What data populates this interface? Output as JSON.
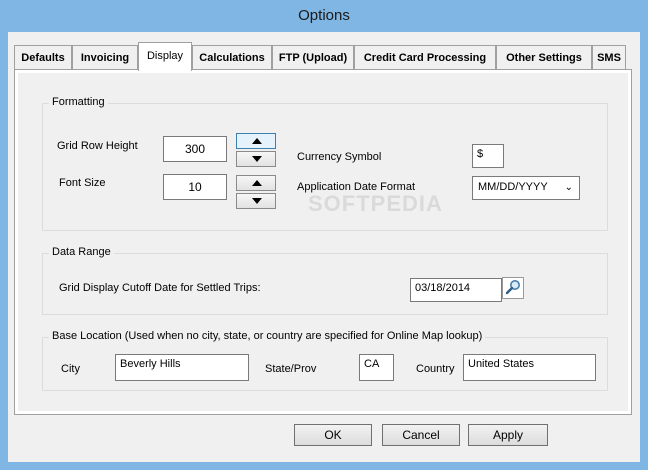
{
  "window": {
    "title": "Options"
  },
  "tabs": [
    {
      "label": "Defaults"
    },
    {
      "label": "Invoicing"
    },
    {
      "label": "Display",
      "active": true
    },
    {
      "label": "Calculations"
    },
    {
      "label": "FTP (Upload)"
    },
    {
      "label": "Credit Card Processing"
    },
    {
      "label": "Other Settings"
    },
    {
      "label": "SMS"
    }
  ],
  "formatting": {
    "group_label": "Formatting",
    "grid_row_height_label": "Grid Row Height",
    "grid_row_height_value": "300",
    "font_size_label": "Font Size",
    "font_size_value": "10",
    "currency_symbol_label": "Currency Symbol",
    "currency_symbol_value": "$",
    "date_format_label": "Application Date Format",
    "date_format_value": "MM/DD/YYYY"
  },
  "data_range": {
    "group_label": "Data Range",
    "cutoff_label": "Grid Display Cutoff Date for Settled Trips:",
    "cutoff_value": "03/18/2014"
  },
  "base_location": {
    "group_label": "Base Location (Used when no city, state, or country are specified for Online Map lookup)",
    "city_label": "City",
    "city_value": "Beverly Hills",
    "state_label": "State/Prov",
    "state_value": "CA",
    "country_label": "Country",
    "country_value": "United States"
  },
  "buttons": {
    "ok": "OK",
    "cancel": "Cancel",
    "apply": "Apply"
  },
  "watermark": "SOFTPEDIA",
  "colors": {
    "frame": "#7fb6e3",
    "background": "#f0f0f0"
  }
}
